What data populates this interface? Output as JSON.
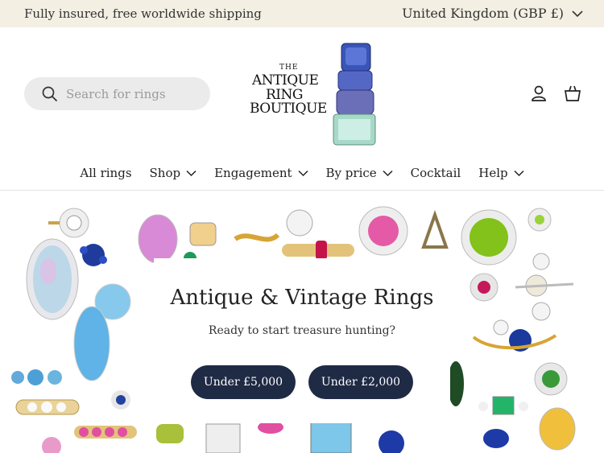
{
  "announcement": {
    "shipping_text": "Fully insured, free worldwide shipping",
    "currency_label": "United Kingdom (GBP £)"
  },
  "header": {
    "search_placeholder": "Search for rings",
    "logo": {
      "line1": "THE",
      "line2": "ANTIQUE",
      "line3": "RING",
      "line4": "BOUTIQUE"
    },
    "icons": [
      "account-icon",
      "cart-icon"
    ]
  },
  "nav": {
    "items": [
      {
        "label": "All rings",
        "has_dropdown": false
      },
      {
        "label": "Shop",
        "has_dropdown": true
      },
      {
        "label": "Engagement",
        "has_dropdown": true
      },
      {
        "label": "By price",
        "has_dropdown": true
      },
      {
        "label": "Cocktail",
        "has_dropdown": false
      },
      {
        "label": "Help",
        "has_dropdown": true
      }
    ]
  },
  "hero": {
    "title": "Antique & Vintage Rings",
    "subtitle": "Ready to start treasure hunting?",
    "buttons": [
      {
        "label": "Under £5,000"
      },
      {
        "label": "Under £2,000"
      }
    ]
  },
  "colors": {
    "announcement_bg": "#f3efe3",
    "button_bg": "#1f2a44",
    "search_bg": "#ebebeb"
  }
}
